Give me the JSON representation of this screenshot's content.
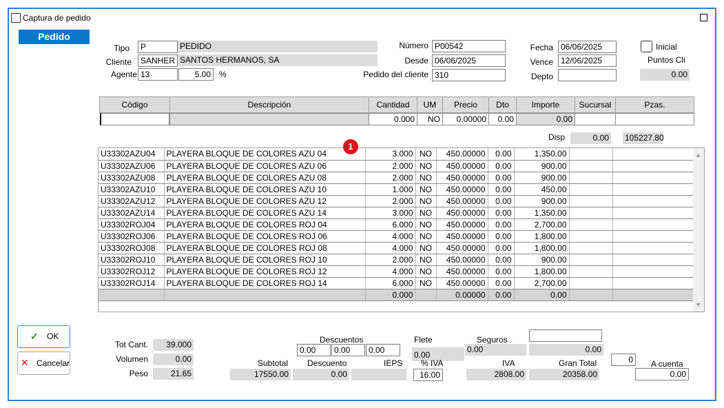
{
  "window": {
    "title": "Captura de pedido"
  },
  "tab": {
    "label": "Pedido"
  },
  "header": {
    "tipo_label": "Tipo",
    "tipo_code": "P",
    "tipo_name": "PEDIDO",
    "cliente_label": "Cliente",
    "cliente_code": "SANHER",
    "cliente_name": "SANTOS HERMANOS, SA",
    "agente_label": "Agente",
    "agente_code": "13",
    "agente_pct": "5.00",
    "pct_sign": "%",
    "numero_label": "Número",
    "numero": "P00542",
    "desde_label": "Desde",
    "desde": "06/06/2025",
    "pedido_cliente_label": "Pedido del cliente",
    "pedido_cliente": "310",
    "fecha_label": "Fecha",
    "fecha": "06/06/2025",
    "vence_label": "Vence",
    "vence": "12/06/2025",
    "depto_label": "Depto",
    "depto": "",
    "inicial_label": "Inicial",
    "puntos_label": "Puntos Cli",
    "puntos": "0.00"
  },
  "entry": {
    "headers": [
      "Código",
      "Descripción",
      "Cantidad",
      "UM",
      "Precio",
      "Dto",
      "Importe",
      "Sucursal",
      "Pzas."
    ],
    "codigo": "",
    "descripcion": "",
    "cantidad": "0.000",
    "um": "NO",
    "precio": "0.00000",
    "dto": "0.00",
    "importe": "0.00",
    "sucursal": "",
    "pzas": "",
    "disp_label": "Disp",
    "disp": "0.00",
    "disp2": "105227.80"
  },
  "badge": "1",
  "rows": [
    [
      "U33302AZU04",
      "PLAYERA BLOQUE DE COLORES AZU 04",
      "3.000",
      "NO",
      "450.00000",
      "0.00",
      "1,350.00"
    ],
    [
      "U33302AZU06",
      "PLAYERA BLOQUE DE COLORES AZU 06",
      "2.000",
      "NO",
      "450.00000",
      "0.00",
      "900.00"
    ],
    [
      "U33302AZU08",
      "PLAYERA BLOQUE DE COLORES AZU 08",
      "2.000",
      "NO",
      "450.00000",
      "0.00",
      "900.00"
    ],
    [
      "U33302AZU10",
      "PLAYERA BLOQUE DE COLORES AZU 10",
      "1.000",
      "NO",
      "450.00000",
      "0.00",
      "450.00"
    ],
    [
      "U33302AZU12",
      "PLAYERA BLOQUE DE COLORES AZU 12",
      "2.000",
      "NO",
      "450.00000",
      "0.00",
      "900.00"
    ],
    [
      "U33302AZU14",
      "PLAYERA BLOQUE DE COLORES AZU 14",
      "3.000",
      "NO",
      "450.00000",
      "0.00",
      "1,350.00"
    ],
    [
      "U33302ROJ04",
      "PLAYERA BLOQUE DE COLORES ROJ 04",
      "6.000",
      "NO",
      "450.00000",
      "0.00",
      "2,700.00"
    ],
    [
      "U33302ROJ06",
      "PLAYERA BLOQUE DE COLORES ROJ 06",
      "4.000",
      "NO",
      "450.00000",
      "0.00",
      "1,800.00"
    ],
    [
      "U33302ROJ08",
      "PLAYERA BLOQUE DE COLORES ROJ 08",
      "4.000",
      "NO",
      "450.00000",
      "0.00",
      "1,800.00"
    ],
    [
      "U33302ROJ10",
      "PLAYERA BLOQUE DE COLORES ROJ 10",
      "2.000",
      "NO",
      "450.00000",
      "0.00",
      "900.00"
    ],
    [
      "U33302ROJ12",
      "PLAYERA BLOQUE DE COLORES ROJ 12",
      "4.000",
      "NO",
      "450.00000",
      "0.00",
      "1,800.00"
    ],
    [
      "U33302ROJ14",
      "PLAYERA BLOQUE DE COLORES ROJ 14",
      "6.000",
      "NO",
      "450.00000",
      "0.00",
      "2,700.00"
    ]
  ],
  "totals_row": {
    "cantidad": "0.000",
    "precio": "0.00000",
    "dto": "0.00",
    "importe": "0.00"
  },
  "buttons": {
    "ok": "OK",
    "cancel": "Cancelar"
  },
  "footer": {
    "tot_cant_label": "Tot Cant.",
    "tot_cant": "39.000",
    "volumen_label": "Volumen",
    "volumen": "0.00",
    "peso_label": "Peso",
    "peso": "21.65",
    "descuentos_label": "Descuentos",
    "desc1": "0.00",
    "desc2": "0.00",
    "desc3": "0.00",
    "flete_label": "Flete",
    "flete": "0.00",
    "seguros_label": "Seguros",
    "seguros": "0.00",
    "otros": "",
    "otros_val": "0.00",
    "subtotal_label": "Subtotal",
    "subtotal": "17550.00",
    "descuento_label": "Descuento",
    "descuento": "0.00",
    "ieps_label": "IEPS",
    "ieps": "",
    "pct_iva_label": "% IVA",
    "pct_iva": "16.00",
    "iva_label": "IVA",
    "iva": "2808.00",
    "gran_total_label": "Gran Total",
    "gran_total": "20358.00",
    "zero_field": "0",
    "a_cuenta_label": "A cuenta",
    "a_cuenta": "0.00"
  },
  "colors": {
    "accent": "#0a78c8",
    "border": "#2a7fd4",
    "badge": "#e0101a"
  }
}
